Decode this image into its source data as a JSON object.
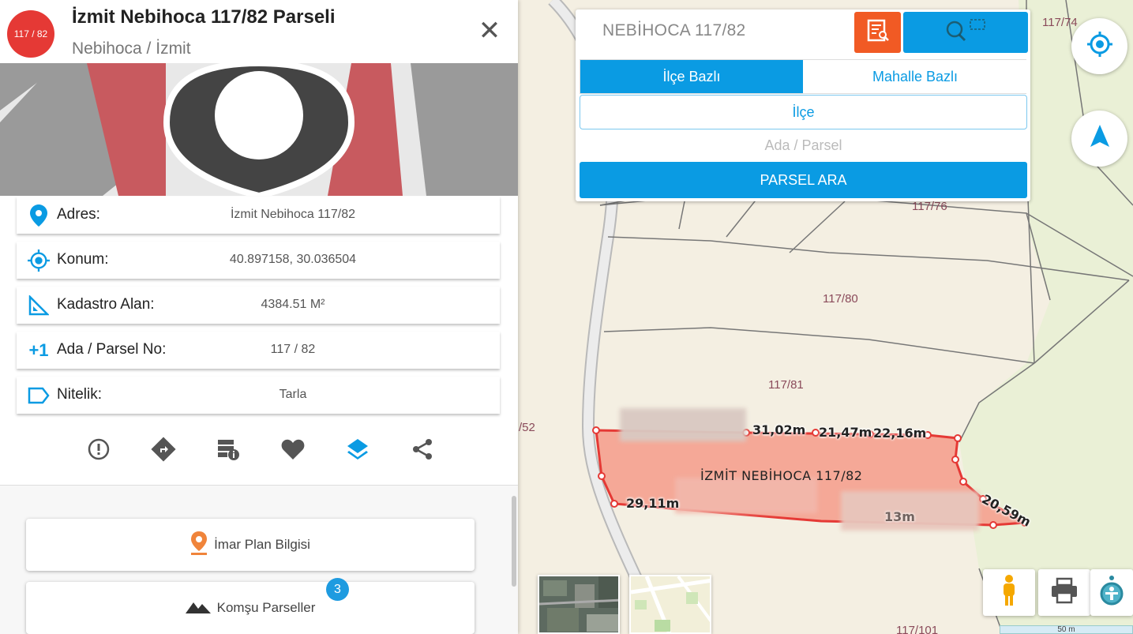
{
  "header": {
    "badge": "117 / 82",
    "title": "İzmit Nebihoca 117/82 Parseli",
    "subtitle": "Nebihoca / İzmit",
    "close_icon": "close-icon"
  },
  "info": {
    "address_label": "Adres:",
    "address_value": "İzmit Nebihoca 117/82",
    "location_label": "Konum:",
    "location_value": "40.897158, 30.036504",
    "area_label": "Kadastro Alan:",
    "area_value": "4384.51 M²",
    "parcel_label": "Ada / Parsel No:",
    "parcel_value": "117 / 82",
    "quality_label": "Nitelik:",
    "quality_value": "Tarla"
  },
  "actions": [
    "alert-icon",
    "directions-icon",
    "server-info-icon",
    "heart-icon",
    "layers-icon",
    "share-icon"
  ],
  "buttons": {
    "imar": "İmar Plan Bilgisi",
    "komsu": "Komşu Parseller",
    "komsu_count": "3"
  },
  "search": {
    "input_value": "NEBİHOCA 117/82",
    "tab_ilce": "İlçe Bazlı",
    "tab_mahalle": "Mahalle Bazlı",
    "ilce": "İlçe",
    "ada_placeholder": "Ada / Parsel",
    "submit": "PARSEL ARA"
  },
  "map": {
    "parcel_labels": {
      "p74": "117/74",
      "p76": "117/76",
      "p80": "117/80",
      "p81": "117/81",
      "p52": "/52",
      "p101": "117/101"
    },
    "measurements": {
      "m1": "31,02m",
      "m2": "21,47m",
      "m3": "22,16m",
      "m4": "29,11m",
      "m5": "20,59m",
      "m6": "13m"
    },
    "selected_parcel": "İZMİT NEBİHOCA 117/82",
    "scale": "50 m",
    "colors": {
      "selected_fill": "#f5a08f",
      "selected_stroke": "#e53935",
      "accent": "#0a9be3",
      "doc_button": "#f15a24"
    }
  }
}
